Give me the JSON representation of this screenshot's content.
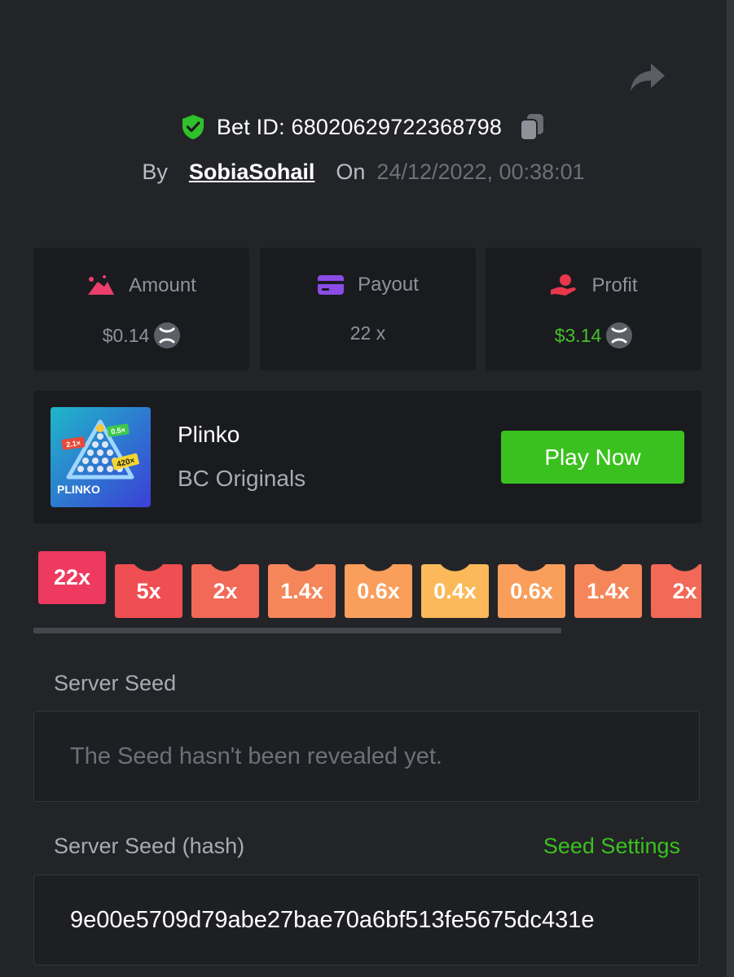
{
  "header": {
    "bet_id": "Bet ID: 68020629722368798",
    "by_label": "By",
    "username": "SobiaSohail",
    "on_label": "On",
    "date": "24/12/2022, 00:38:01"
  },
  "stats": {
    "amount": {
      "label": "Amount",
      "value": "$0.14"
    },
    "payout": {
      "label": "Payout",
      "value": "22 x"
    },
    "profit": {
      "label": "Profit",
      "value": "$3.14"
    }
  },
  "game": {
    "name": "Plinko",
    "provider": "BC Originals",
    "play_label": "Play Now",
    "thumb": {
      "brand": "PLINKO",
      "tag1": "2.1×",
      "tag2": "0.5×",
      "tag3": "420×"
    }
  },
  "multipliers": [
    {
      "label": "22x",
      "color": "#ee3a5e",
      "active": true
    },
    {
      "label": "5x",
      "color": "#ef4f53"
    },
    {
      "label": "2x",
      "color": "#f26a57"
    },
    {
      "label": "1.4x",
      "color": "#f5865a"
    },
    {
      "label": "0.6x",
      "color": "#f99f5b"
    },
    {
      "label": "0.4x",
      "color": "#fbb95a"
    },
    {
      "label": "0.6x",
      "color": "#f99f5b"
    },
    {
      "label": "1.4x",
      "color": "#f5865a"
    },
    {
      "label": "2x",
      "color": "#f26a57"
    }
  ],
  "server_seed": {
    "label": "Server Seed",
    "value": "The Seed hasn't been revealed yet."
  },
  "server_seed_hash": {
    "label": "Server Seed (hash)",
    "settings_label": "Seed Settings",
    "value": "9e00e5709d79abe27bae70a6bf513fe5675dc431e"
  },
  "colors": {
    "accent_green": "#3bc11f",
    "background": "#232427",
    "card": "#1a1b1e"
  }
}
